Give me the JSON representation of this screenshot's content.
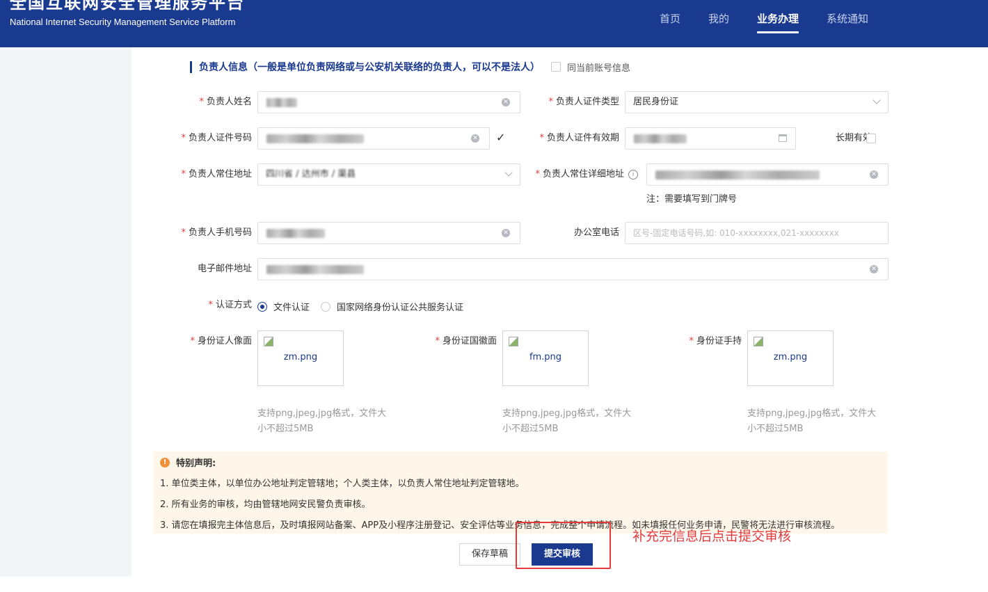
{
  "header": {
    "title": "全国互联网安全管理服务平台",
    "subtitle": "National Internet Security Management Service Platform",
    "nav": [
      {
        "label": "首页",
        "active": false
      },
      {
        "label": "我的",
        "active": false
      },
      {
        "label": "业务办理",
        "active": true
      },
      {
        "label": "系统通知",
        "active": false
      }
    ]
  },
  "section": {
    "title": "负责人信息（一般是单位负责网络或与公安机关联络的负责人，可以不是法人）",
    "same_as_account": "同当前账号信息"
  },
  "form": {
    "name_label": "负责人姓名",
    "id_type_label": "负责人证件类型",
    "id_type_value": "居民身份证",
    "id_number_label": "负责人证件号码",
    "id_valid_label": "负责人证件有效期",
    "long_term_label": "长期有效",
    "address_label": "负责人常住地址",
    "address_value": "四川省 / 达州市 / 渠县",
    "detail_address_label": "负责人常住详细地址",
    "detail_address_note": "注：需要填写到门牌号",
    "phone_label": "负责人手机号码",
    "office_phone_label": "办公室电话",
    "office_phone_placeholder": "区号-固定电话号码,如: 010-xxxxxxxx,021-xxxxxxxx",
    "email_label": "电子邮件地址",
    "auth_label": "认证方式",
    "auth_options": [
      "文件认证",
      "国家网络身份认证公共服务认证"
    ],
    "auth_selected": "文件认证"
  },
  "uploads": [
    {
      "label": "身份证人像面",
      "file": "zm.png"
    },
    {
      "label": "身份证国徽面",
      "file": "fm.png"
    },
    {
      "label": "身份证手持",
      "file": "zm.png"
    }
  ],
  "upload_hint_line1": "支持png,jpeg,jpg格式，文件大",
  "upload_hint_line2": "小不超过5MB",
  "notice": {
    "title": "特别声明:",
    "lines": [
      "1. 单位类主体，以单位办公地址判定管辖地；个人类主体，以负责人常住地址判定管辖地。",
      "2. 所有业务的审核，均由管辖地网安民警负责审核。",
      "3. 请您在填报完主体信息后，及时填报网站备案、APP及小程序注册登记、安全评估等业务信息，完成整个申请流程。如未填报任何业务申请，民警将无法进行审核流程。"
    ]
  },
  "buttons": {
    "save_draft": "保存草稿",
    "submit": "提交审核"
  },
  "annotation": "补充完信息后点击提交审核",
  "colors": {
    "header_bg": "#1a3a8f",
    "accent": "#1a3a8f",
    "required": "#e23b3b",
    "annotation": "#e33b3b",
    "notice_bg": "#fdf6e9"
  }
}
